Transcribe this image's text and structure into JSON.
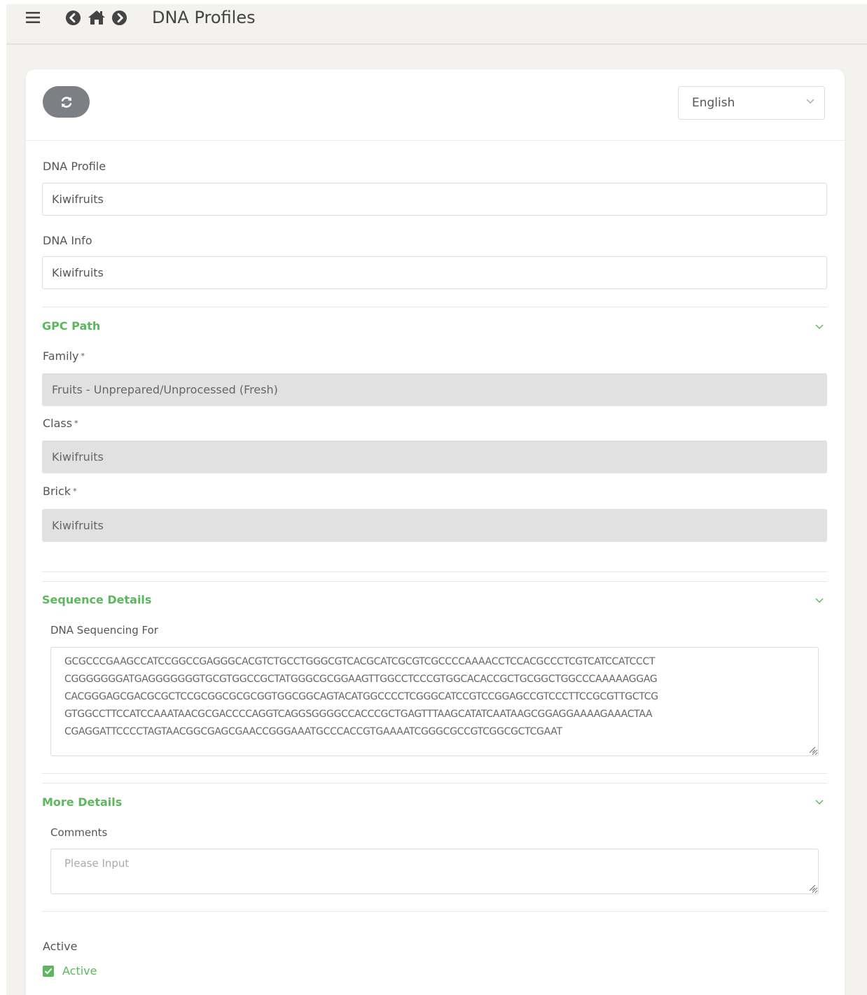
{
  "header": {
    "title": "DNA Profiles",
    "icons": [
      "menu-icon",
      "back-icon",
      "home-icon",
      "forward-icon"
    ]
  },
  "toolbar": {
    "refresh_icon": "refresh-icon",
    "language": {
      "selected": "English"
    }
  },
  "form": {
    "dna_profile": {
      "label": "DNA Profile",
      "value": "Kiwifruits"
    },
    "dna_info": {
      "label": "DNA Info",
      "value": "Kiwifruits"
    },
    "gpc_path": {
      "title": "GPC Path",
      "family": {
        "label": "Family",
        "value": "Fruits - Unprepared/Unprocessed (Fresh)"
      },
      "class": {
        "label": "Class",
        "value": "Kiwifruits"
      },
      "brick": {
        "label": "Brick",
        "value": "Kiwifruits"
      },
      "required_mark": "*"
    },
    "sequence_details": {
      "title": "Sequence Details",
      "label": "DNA Sequencing For",
      "lines": [
        "GCGCCCGAAGCCATCCGGCCGAGGGCACGTCTGCCTGGGCGTCACGCATCGCGTCGCCCCAAAACCTCCACGCCCTCGTCATCCATCCCT",
        "CGGGGGGGATGAGGGGGGGTGCGTGGCCGCTATGGGCGCGGAAGTTGGCCTCCCGTGGCACACCGCTGCGGCTGGCCCAAAAAGGAG",
        "CACGGGAGCGACGCGCTCCGCGGCGCGCGGTGGCGGCAGTACATGGCCCCTCGGGCATCCGTCCGGAGCCGTCCCTTCCGCGTTGCTCG",
        "GTGGCCTTCCATCCAAATAACGCGACCCCAGGTCAGGSGGGGCCACCCGCTGAGTTTAAGCATATCAATAAGCGGAGGAAAAGAAACTAA",
        "CGAGGATTCCCCTAGTAACGGCGAGCGAACCGGGAAATGCCCACCGTGAAAATCGGGCGCCGTCGGCGCTCGAAT"
      ]
    },
    "more_details": {
      "title": "More Details",
      "comments": {
        "label": "Comments",
        "placeholder": "Please Input",
        "value": ""
      }
    },
    "active": {
      "label": "Active",
      "checkbox_label": "Active",
      "checked": true
    }
  },
  "colors": {
    "accent_green": "#5cb85c",
    "refresh_button": "#7c7f86",
    "disabled_field": "#e1e1e1",
    "page_bg": "#f4f2ef"
  }
}
